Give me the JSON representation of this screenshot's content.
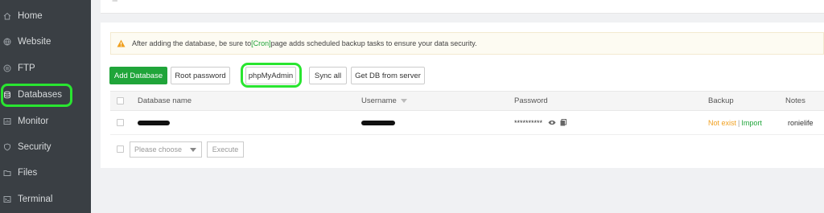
{
  "sidebar": {
    "items": [
      {
        "label": "Home",
        "icon": "home-icon"
      },
      {
        "label": "Website",
        "icon": "globe-icon"
      },
      {
        "label": "FTP",
        "icon": "ftp-icon"
      },
      {
        "label": "Databases",
        "icon": "database-icon",
        "active": true
      },
      {
        "label": "Monitor",
        "icon": "monitor-icon"
      },
      {
        "label": "Security",
        "icon": "shield-icon"
      },
      {
        "label": "Files",
        "icon": "folder-icon"
      },
      {
        "label": "Terminal",
        "icon": "terminal-icon"
      }
    ]
  },
  "notice": {
    "text_before": "After adding the database, be sure to ",
    "cron_link": "[Cron]",
    "text_after": " page adds scheduled backup tasks to ensure your data security."
  },
  "toolbar": {
    "add_database": "Add Database",
    "root_password": "Root password",
    "phpmyadmin": "phpMyAdmin",
    "sync_all": "Sync all",
    "get_db_from_server": "Get DB from server"
  },
  "table": {
    "headers": {
      "database_name": "Database name",
      "username": "Username",
      "password": "Password",
      "backup": "Backup",
      "notes": "Notes"
    },
    "rows": [
      {
        "password_masked": "**********",
        "backup_status": "Not exist",
        "backup_separator": "|",
        "backup_action": "Import",
        "notes": "ronielife"
      }
    ]
  },
  "batch": {
    "select_placeholder": "Please choose",
    "execute_label": "Execute"
  },
  "colors": {
    "brand_green": "#20a53a",
    "highlight_green": "#29e530",
    "warning_orange": "#f0a020",
    "sidebar_bg": "#3a3f44"
  }
}
